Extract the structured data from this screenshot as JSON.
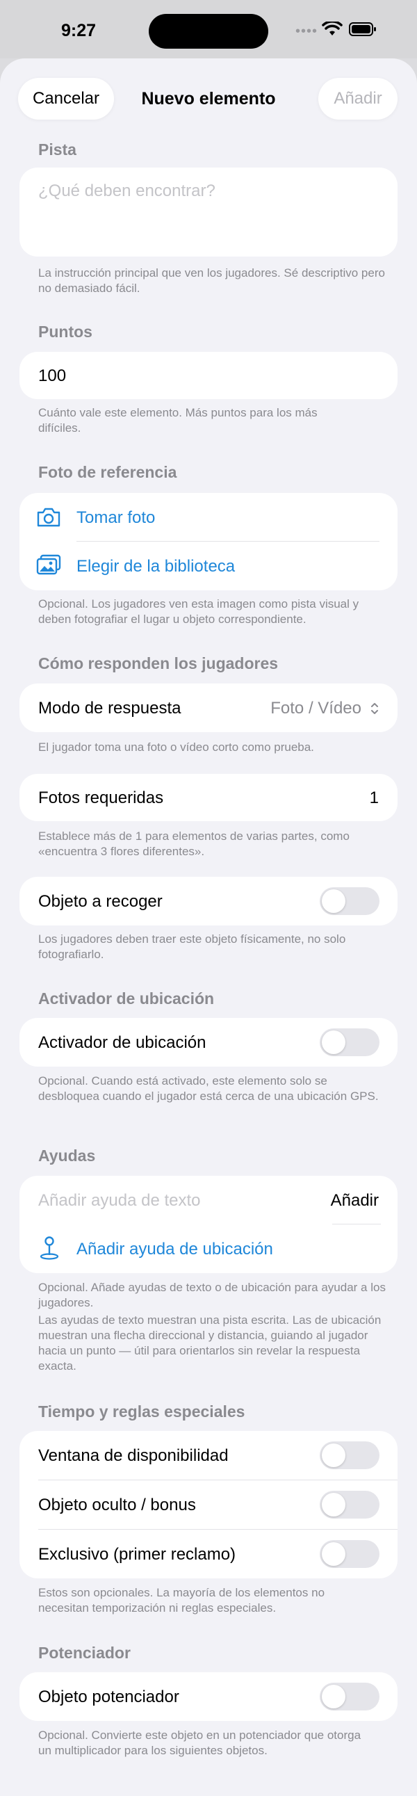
{
  "status": {
    "time": "9:27"
  },
  "nav": {
    "cancel": "Cancelar",
    "title": "Nuevo elemento",
    "add": "Añadir"
  },
  "pista": {
    "header": "Pista",
    "placeholder": "¿Qué deben encontrar?",
    "footnote": "La instrucción principal que ven los jugadores. Sé descriptivo pero no demasiado fácil."
  },
  "puntos": {
    "header": "Puntos",
    "value": "100",
    "footnote": "Cuánto vale este elemento. Más puntos para los más difíciles."
  },
  "foto": {
    "header": "Foto de referencia",
    "take": "Tomar foto",
    "library": "Elegir de la biblioteca",
    "footnote": "Opcional. Los jugadores ven esta imagen como pista visual y deben fotografiar el lugar u objeto correspondiente."
  },
  "respuesta": {
    "header": "Cómo responden los jugadores",
    "mode_label": "Modo de respuesta",
    "mode_value": "Foto / Vídeo",
    "mode_footnote": "El jugador toma una foto o vídeo corto como prueba.",
    "photos_label": "Fotos requeridas",
    "photos_value": "1",
    "photos_footnote": "Establece más de 1 para elementos de varias partes, como «encuentra 3 flores diferentes».",
    "collect_label": "Objeto a recoger",
    "collect_on": false,
    "collect_footnote": "Los jugadores deben traer este objeto físicamente, no solo fotografiarlo."
  },
  "ubicacion": {
    "header": "Activador de ubicación",
    "label": "Activador de ubicación",
    "on": false,
    "footnote": "Opcional. Cuando está activado, este elemento solo se desbloquea cuando el jugador está cerca de una ubicación GPS."
  },
  "ayudas": {
    "header": "Ayudas",
    "text_placeholder": "Añadir ayuda de texto",
    "text_add": "Añadir",
    "location": "Añadir ayuda de ubicación",
    "footnote1": "Opcional. Añade ayudas de texto o de ubicación para ayudar a los jugadores.",
    "footnote2": "Las ayudas de texto muestran una pista escrita. Las de ubicación muestran una flecha direccional y distancia, guiando al jugador hacia un punto — útil para orientarlos sin revelar la respuesta exacta."
  },
  "tiempo": {
    "header": "Tiempo y reglas especiales",
    "window": "Ventana de disponibilidad",
    "hidden": "Objeto oculto / bonus",
    "exclusive": "Exclusivo (primer reclamo)",
    "footnote": "Estos son opcionales. La mayoría de los elementos no necesitan temporización ni reglas especiales."
  },
  "potenciador": {
    "header": "Potenciador",
    "label": "Objeto potenciador",
    "footnote": "Opcional. Convierte este objeto en un potenciador que otorga un multiplicador para los siguientes objetos."
  },
  "colors": {
    "accent": "#1f87d9",
    "secondary": "#8a8a8f",
    "background": "#f2f2f7"
  }
}
